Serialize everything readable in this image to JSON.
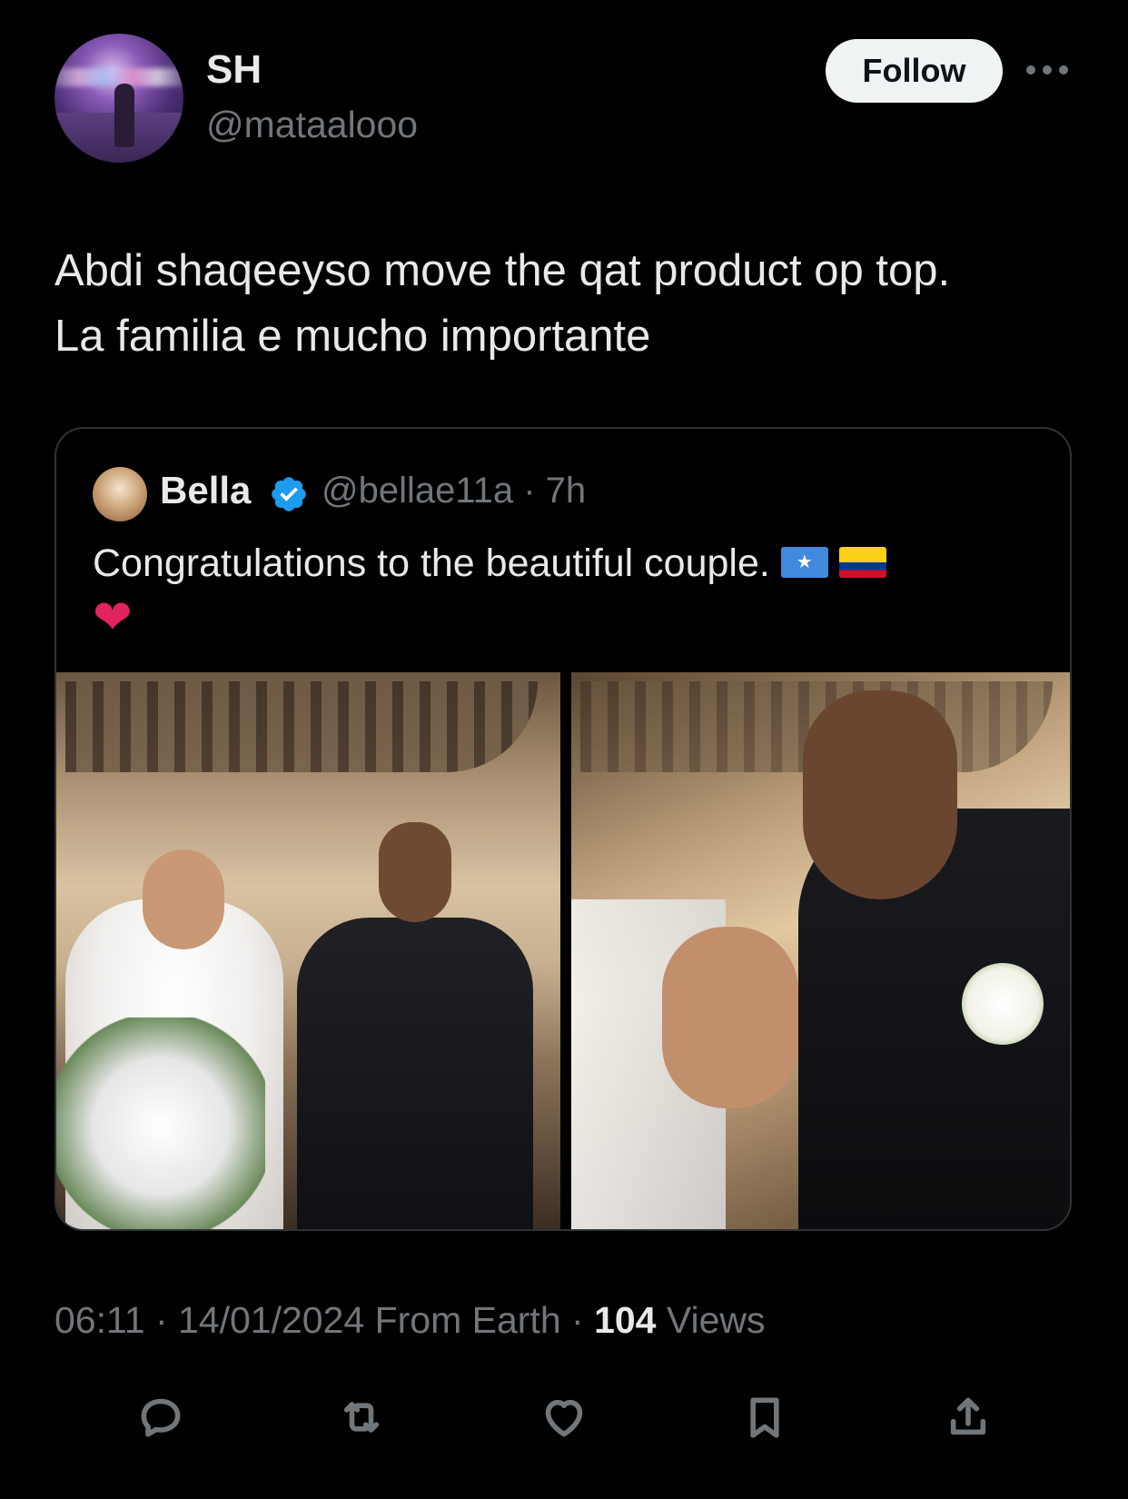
{
  "author": {
    "display_name": "SH",
    "handle": "@mataalooo",
    "follow_label": "Follow"
  },
  "tweet": {
    "text_line1": "Abdi shaqeeyso move the qat product op top.",
    "text_line2": "La familia e mucho importante"
  },
  "quote": {
    "display_name": "Bella",
    "handle_time": "@bellae11a · 7h",
    "text": "Congratulations to the beautiful couple.",
    "emojis": [
      "somalia-flag",
      "colombia-flag",
      "red-heart"
    ],
    "heart": "❤"
  },
  "meta": {
    "time_date": "06:11 · 14/01/2024 From Earth · ",
    "views_count": "104",
    "views_label": " Views"
  },
  "actions": [
    "reply-icon",
    "retweet-icon",
    "like-icon",
    "bookmark-icon",
    "share-icon"
  ],
  "colors": {
    "background": "#000000",
    "primary_text": "#e7e9ea",
    "secondary_text": "#71767b",
    "verified": "#1d9bf0",
    "border": "#2f3336"
  }
}
